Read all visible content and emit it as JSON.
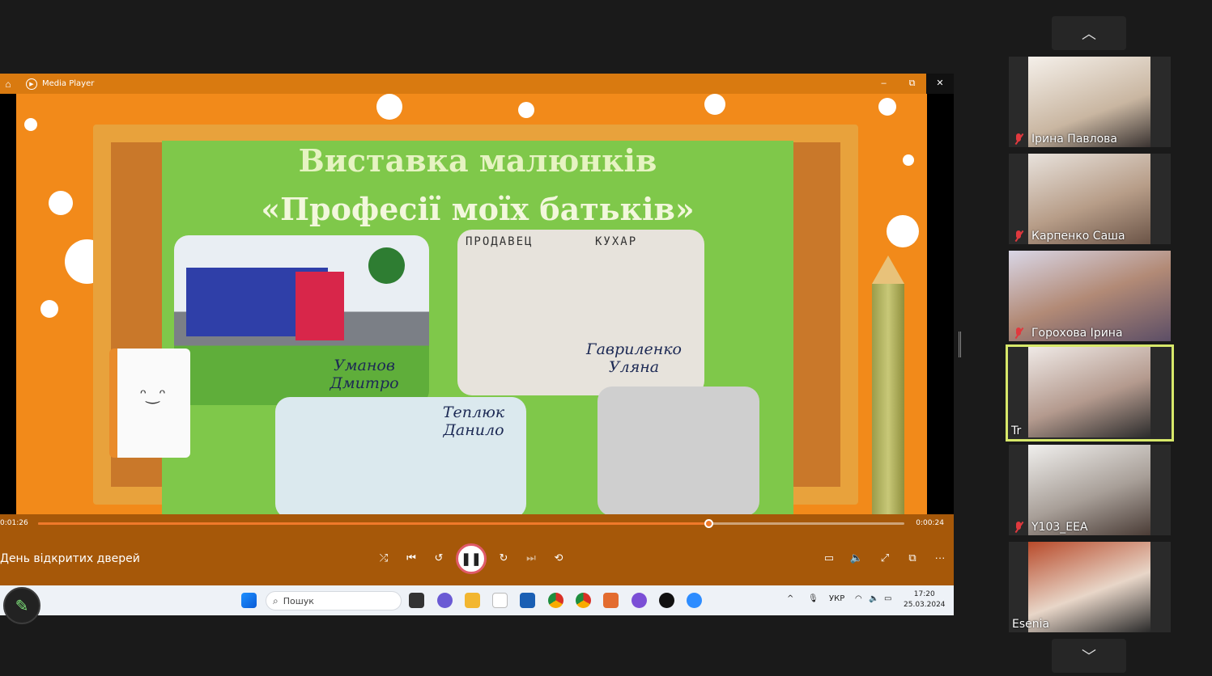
{
  "media_player": {
    "app_title": "Media Player",
    "window_controls": {
      "minimize": "–",
      "restore": "⧉",
      "close": "✕"
    },
    "slide": {
      "title_line1": "Виставка малюнків",
      "title_line2": "«Професії моїх батьків»",
      "captions": [
        "Уманов Дмитро",
        "Гавриленко Уляна",
        "Теплюк Данило"
      ],
      "labels": [
        "ПРОДАВЕЦ",
        "КУХАР"
      ]
    },
    "time_elapsed": "0:01:26",
    "time_remaining": "0:00:24",
    "progress": 0.775,
    "media_title": "День відкритих дверей",
    "controls": {
      "shuffle": "⤮",
      "previous": "⏮",
      "rewind": "↺",
      "pause": "❚❚",
      "forward": "↻",
      "next": "⏭",
      "repeat": "⟲",
      "captions": "▭",
      "volume": "🔈",
      "fullscreen": "⤢",
      "miniplayer": "⧉",
      "more": "···"
    }
  },
  "taskbar": {
    "search_placeholder": "Пошук",
    "language": "УКР",
    "time": "17:20",
    "date": "25.03.2024"
  },
  "participants": [
    {
      "name": "Ірина Павлова",
      "muted": true,
      "active": false
    },
    {
      "name": "Карпенко Саша",
      "muted": true,
      "active": false
    },
    {
      "name": "Горохова Ірина",
      "muted": true,
      "active": false
    },
    {
      "name": "Tr",
      "muted": false,
      "active": true
    },
    {
      "name": "Y103_EEA",
      "muted": true,
      "active": false
    },
    {
      "name": "Esenia",
      "muted": false,
      "active": false
    }
  ],
  "colors": {
    "accent": "#f07a2a",
    "active_speaker": "#d7e86a",
    "mute": "#e0393e"
  }
}
